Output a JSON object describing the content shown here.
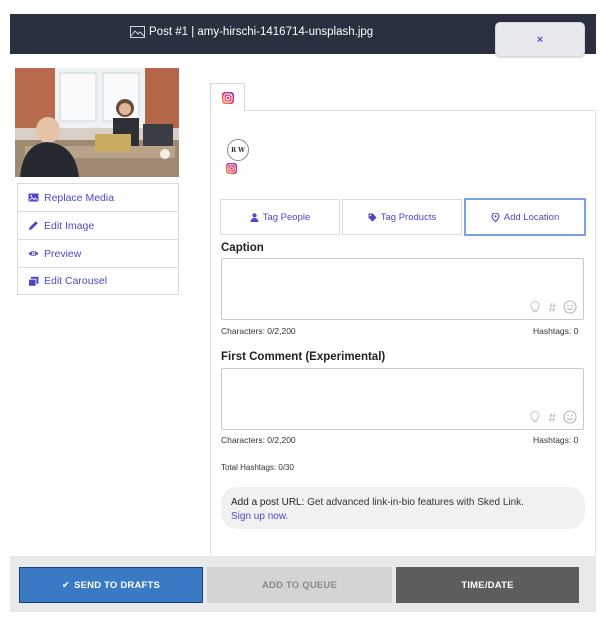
{
  "header": {
    "title": "Post #1 | amy-hirschi-1416714-unsplash.jpg",
    "close_label": "×"
  },
  "thumbnail": {
    "alt": "Two people meeting at a table with a laptop"
  },
  "media_actions": [
    {
      "label": "Replace Media",
      "icon": "image-icon"
    },
    {
      "label": "Edit Image",
      "icon": "pencil-icon"
    },
    {
      "label": "Preview",
      "icon": "eye-icon"
    },
    {
      "label": "Edit Carousel",
      "icon": "carousel-icon"
    }
  ],
  "platform_tab": {
    "icon": "instagram-icon"
  },
  "account": {
    "avatar_text": "R W",
    "platform_icon": "instagram-icon"
  },
  "tag_buttons": [
    {
      "label": "Tag People",
      "icon": "user-icon"
    },
    {
      "label": "Tag Products",
      "icon": "tag-icon"
    },
    {
      "label": "Add Location",
      "icon": "map-pin-icon"
    }
  ],
  "caption": {
    "label": "Caption",
    "value": "",
    "characters": "Characters: 0/2,200",
    "hashtags": "Hashtags: 0"
  },
  "first_comment": {
    "label": "First Comment (Experimental)",
    "value": "",
    "characters": "Characters: 0/2,200",
    "hashtags": "Hashtags: 0"
  },
  "total_hashtags": "Total Hashtags: 0/30",
  "url_promo": {
    "lead": "Add a post URL:",
    "text": "Get advanced link-in-bio features with Sked Link.",
    "link": "Sign up now."
  },
  "footer": {
    "drafts_label": "SEND TO DRAFTS",
    "queue_label": "ADD TO QUEUE",
    "timedate_label": "TIME/DATE"
  },
  "colors": {
    "accent": "#4e48c8",
    "header_bg": "#2b3040",
    "primary_button": "#3a7ac4",
    "dark_button": "#5d5d5d"
  }
}
